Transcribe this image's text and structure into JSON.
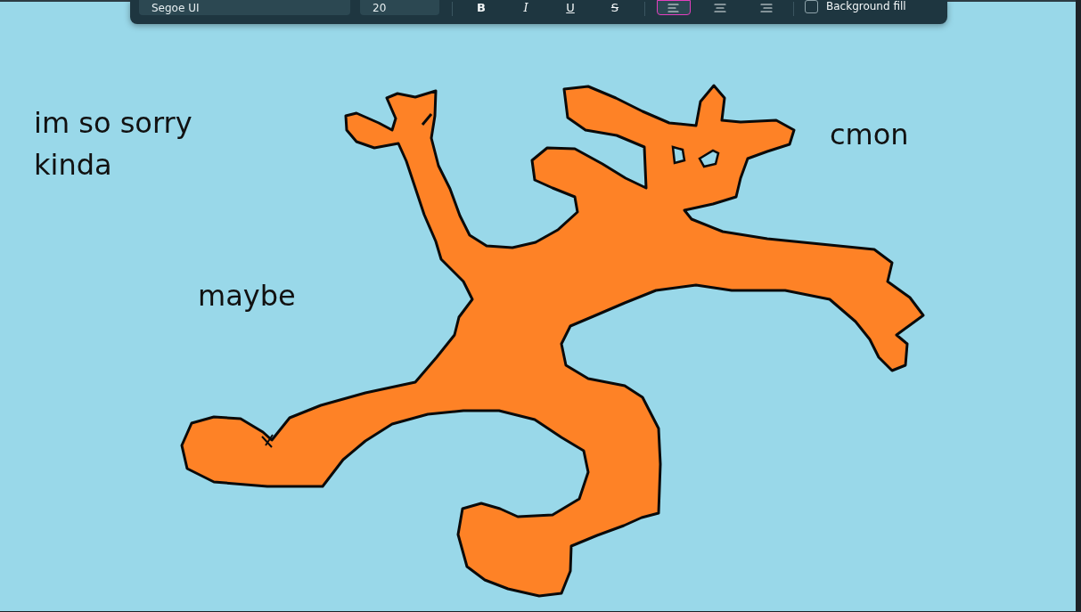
{
  "toolbar": {
    "font": {
      "value": "Segoe UI"
    },
    "size": {
      "value": "20"
    },
    "format_buttons": [
      {
        "kind": "bold",
        "label": "B"
      },
      {
        "kind": "italic",
        "label": "I"
      },
      {
        "kind": "underline",
        "label": "U"
      },
      {
        "kind": "strikethrough",
        "label": "S"
      }
    ],
    "align_buttons": [
      {
        "kind": "left",
        "selected": true
      },
      {
        "kind": "center",
        "selected": false
      },
      {
        "kind": "right",
        "selected": false
      }
    ],
    "background_fill": {
      "label": "Background fill",
      "checked": false
    }
  },
  "canvas": {
    "texts": [
      {
        "text": "im so sorry\nkinda"
      },
      {
        "text": "maybe"
      },
      {
        "text": "cmon"
      }
    ]
  }
}
